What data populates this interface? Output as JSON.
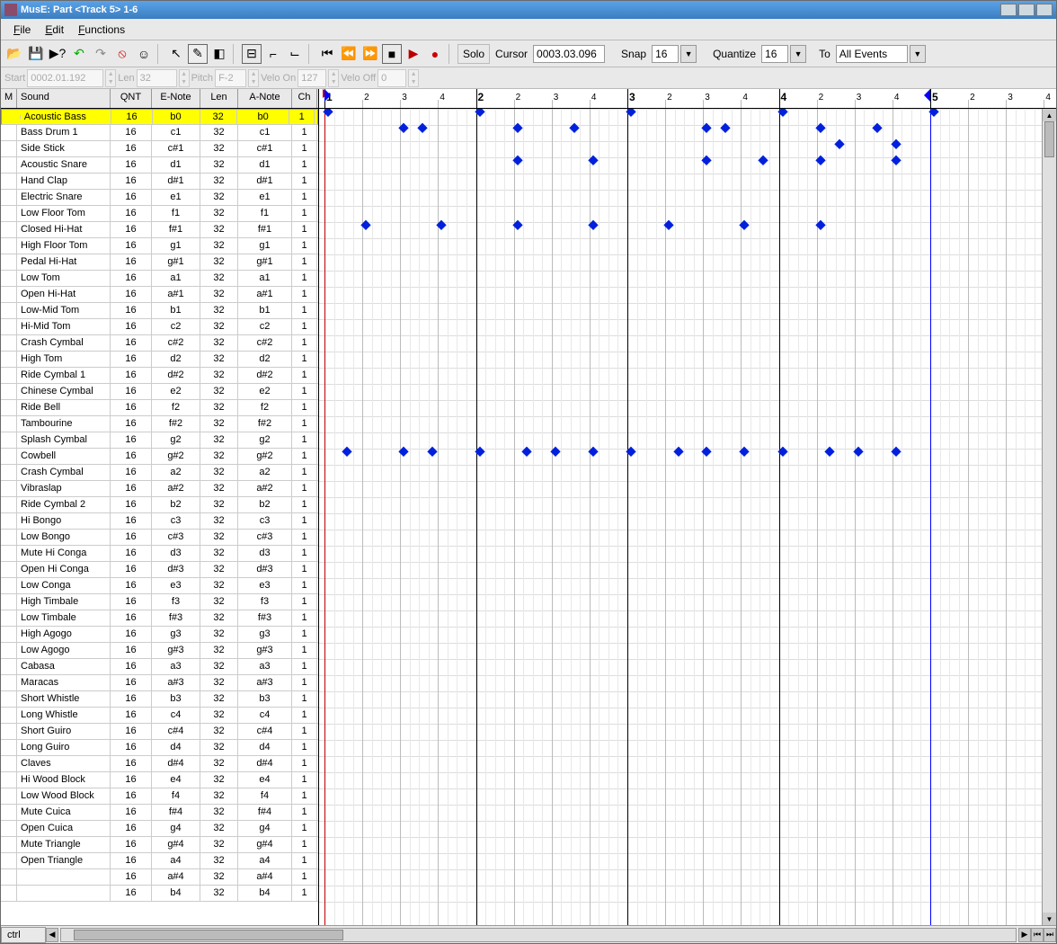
{
  "title": "MusE: Part <Track 5> 1-6",
  "menu": {
    "file": "File",
    "edit": "Edit",
    "functions": "Functions"
  },
  "toolbar": {
    "solo": "Solo",
    "cursor_lbl": "Cursor",
    "cursor_val": "0003.03.096",
    "snap_lbl": "Snap",
    "snap_val": "16",
    "quant_lbl": "Quantize",
    "quant_val": "16",
    "to_lbl": "To",
    "to_val": "All Events"
  },
  "info": {
    "start_lbl": "Start",
    "start": "0002.01.192",
    "len_lbl": "Len",
    "len": "32",
    "pitch_lbl": "Pitch",
    "pitch": "F-2",
    "von_lbl": "Velo On",
    "von": "127",
    "voff_lbl": "Velo Off",
    "voff": "0"
  },
  "headers": {
    "m": "M",
    "sound": "Sound",
    "qnt": "QNT",
    "enote": "E-Note",
    "len": "Len",
    "anote": "A-Note",
    "ch": "Ch"
  },
  "selected": 0,
  "bottom": {
    "ctrl": "ctrl"
  },
  "sounds": [
    {
      "name": "Acoustic Bass",
      "q": "16",
      "e": "b0",
      "l": "32",
      "a": "b0",
      "c": "1"
    },
    {
      "name": "Bass Drum 1",
      "q": "16",
      "e": "c1",
      "l": "32",
      "a": "c1",
      "c": "1"
    },
    {
      "name": "Side Stick",
      "q": "16",
      "e": "c#1",
      "l": "32",
      "a": "c#1",
      "c": "1"
    },
    {
      "name": "Acoustic Snare",
      "q": "16",
      "e": "d1",
      "l": "32",
      "a": "d1",
      "c": "1"
    },
    {
      "name": "Hand Clap",
      "q": "16",
      "e": "d#1",
      "l": "32",
      "a": "d#1",
      "c": "1"
    },
    {
      "name": "Electric Snare",
      "q": "16",
      "e": "e1",
      "l": "32",
      "a": "e1",
      "c": "1"
    },
    {
      "name": "Low Floor Tom",
      "q": "16",
      "e": "f1",
      "l": "32",
      "a": "f1",
      "c": "1"
    },
    {
      "name": "Closed Hi-Hat",
      "q": "16",
      "e": "f#1",
      "l": "32",
      "a": "f#1",
      "c": "1"
    },
    {
      "name": "High Floor Tom",
      "q": "16",
      "e": "g1",
      "l": "32",
      "a": "g1",
      "c": "1"
    },
    {
      "name": "Pedal Hi-Hat",
      "q": "16",
      "e": "g#1",
      "l": "32",
      "a": "g#1",
      "c": "1"
    },
    {
      "name": "Low Tom",
      "q": "16",
      "e": "a1",
      "l": "32",
      "a": "a1",
      "c": "1"
    },
    {
      "name": "Open Hi-Hat",
      "q": "16",
      "e": "a#1",
      "l": "32",
      "a": "a#1",
      "c": "1"
    },
    {
      "name": "Low-Mid Tom",
      "q": "16",
      "e": "b1",
      "l": "32",
      "a": "b1",
      "c": "1"
    },
    {
      "name": "Hi-Mid Tom",
      "q": "16",
      "e": "c2",
      "l": "32",
      "a": "c2",
      "c": "1"
    },
    {
      "name": "Crash Cymbal",
      "q": "16",
      "e": "c#2",
      "l": "32",
      "a": "c#2",
      "c": "1"
    },
    {
      "name": "High Tom",
      "q": "16",
      "e": "d2",
      "l": "32",
      "a": "d2",
      "c": "1"
    },
    {
      "name": "Ride Cymbal 1",
      "q": "16",
      "e": "d#2",
      "l": "32",
      "a": "d#2",
      "c": "1"
    },
    {
      "name": "Chinese Cymbal",
      "q": "16",
      "e": "e2",
      "l": "32",
      "a": "e2",
      "c": "1"
    },
    {
      "name": "Ride Bell",
      "q": "16",
      "e": "f2",
      "l": "32",
      "a": "f2",
      "c": "1"
    },
    {
      "name": "Tambourine",
      "q": "16",
      "e": "f#2",
      "l": "32",
      "a": "f#2",
      "c": "1"
    },
    {
      "name": "Splash Cymbal",
      "q": "16",
      "e": "g2",
      "l": "32",
      "a": "g2",
      "c": "1"
    },
    {
      "name": "Cowbell",
      "q": "16",
      "e": "g#2",
      "l": "32",
      "a": "g#2",
      "c": "1"
    },
    {
      "name": "Crash Cymbal",
      "q": "16",
      "e": "a2",
      "l": "32",
      "a": "a2",
      "c": "1"
    },
    {
      "name": "Vibraslap",
      "q": "16",
      "e": "a#2",
      "l": "32",
      "a": "a#2",
      "c": "1"
    },
    {
      "name": "Ride Cymbal 2",
      "q": "16",
      "e": "b2",
      "l": "32",
      "a": "b2",
      "c": "1"
    },
    {
      "name": "Hi Bongo",
      "q": "16",
      "e": "c3",
      "l": "32",
      "a": "c3",
      "c": "1"
    },
    {
      "name": "Low Bongo",
      "q": "16",
      "e": "c#3",
      "l": "32",
      "a": "c#3",
      "c": "1"
    },
    {
      "name": "Mute Hi Conga",
      "q": "16",
      "e": "d3",
      "l": "32",
      "a": "d3",
      "c": "1"
    },
    {
      "name": "Open Hi Conga",
      "q": "16",
      "e": "d#3",
      "l": "32",
      "a": "d#3",
      "c": "1"
    },
    {
      "name": "Low Conga",
      "q": "16",
      "e": "e3",
      "l": "32",
      "a": "e3",
      "c": "1"
    },
    {
      "name": "High Timbale",
      "q": "16",
      "e": "f3",
      "l": "32",
      "a": "f3",
      "c": "1"
    },
    {
      "name": "Low Timbale",
      "q": "16",
      "e": "f#3",
      "l": "32",
      "a": "f#3",
      "c": "1"
    },
    {
      "name": "High Agogo",
      "q": "16",
      "e": "g3",
      "l": "32",
      "a": "g3",
      "c": "1"
    },
    {
      "name": "Low Agogo",
      "q": "16",
      "e": "g#3",
      "l": "32",
      "a": "g#3",
      "c": "1"
    },
    {
      "name": "Cabasa",
      "q": "16",
      "e": "a3",
      "l": "32",
      "a": "a3",
      "c": "1"
    },
    {
      "name": "Maracas",
      "q": "16",
      "e": "a#3",
      "l": "32",
      "a": "a#3",
      "c": "1"
    },
    {
      "name": "Short Whistle",
      "q": "16",
      "e": "b3",
      "l": "32",
      "a": "b3",
      "c": "1"
    },
    {
      "name": "Long Whistle",
      "q": "16",
      "e": "c4",
      "l": "32",
      "a": "c4",
      "c": "1"
    },
    {
      "name": "Short Guiro",
      "q": "16",
      "e": "c#4",
      "l": "32",
      "a": "c#4",
      "c": "1"
    },
    {
      "name": "Long Guiro",
      "q": "16",
      "e": "d4",
      "l": "32",
      "a": "d4",
      "c": "1"
    },
    {
      "name": "Claves",
      "q": "16",
      "e": "d#4",
      "l": "32",
      "a": "d#4",
      "c": "1"
    },
    {
      "name": "Hi Wood Block",
      "q": "16",
      "e": "e4",
      "l": "32",
      "a": "e4",
      "c": "1"
    },
    {
      "name": "Low Wood Block",
      "q": "16",
      "e": "f4",
      "l": "32",
      "a": "f4",
      "c": "1"
    },
    {
      "name": "Mute Cuica",
      "q": "16",
      "e": "f#4",
      "l": "32",
      "a": "f#4",
      "c": "1"
    },
    {
      "name": "Open Cuica",
      "q": "16",
      "e": "g4",
      "l": "32",
      "a": "g4",
      "c": "1"
    },
    {
      "name": "Mute Triangle",
      "q": "16",
      "e": "g#4",
      "l": "32",
      "a": "g#4",
      "c": "1"
    },
    {
      "name": "Open Triangle",
      "q": "16",
      "e": "a4",
      "l": "32",
      "a": "a4",
      "c": "1"
    },
    {
      "name": "",
      "q": "16",
      "e": "a#4",
      "l": "32",
      "a": "a#4",
      "c": "1"
    },
    {
      "name": "",
      "q": "16",
      "e": "b4",
      "l": "32",
      "a": "b4",
      "c": "1"
    }
  ],
  "grid": {
    "bars": 5,
    "beats_per_bar": 4,
    "subs_per_beat": 4,
    "bar_width": 168.5,
    "play_bar": 1,
    "play_beat": 0,
    "locL_bar": 1,
    "locR_bar": 5,
    "offset": 6
  },
  "notes": [
    {
      "r": 0,
      "b": 1,
      "t": 0
    },
    {
      "r": 0,
      "b": 2,
      "t": 0
    },
    {
      "r": 0,
      "b": 3,
      "t": 0
    },
    {
      "r": 0,
      "b": 4,
      "t": 0
    },
    {
      "r": 0,
      "b": 5,
      "t": 0
    },
    {
      "r": 1,
      "b": 1,
      "t": 8
    },
    {
      "r": 1,
      "b": 1,
      "t": 10
    },
    {
      "r": 1,
      "b": 2,
      "t": 4
    },
    {
      "r": 1,
      "b": 2,
      "t": 10
    },
    {
      "r": 1,
      "b": 3,
      "t": 8
    },
    {
      "r": 1,
      "b": 3,
      "t": 10
    },
    {
      "r": 1,
      "b": 4,
      "t": 4
    },
    {
      "r": 1,
      "b": 4,
      "t": 10
    },
    {
      "r": 2,
      "b": 4,
      "t": 6
    },
    {
      "r": 2,
      "b": 4,
      "t": 12
    },
    {
      "r": 3,
      "b": 2,
      "t": 4
    },
    {
      "r": 3,
      "b": 2,
      "t": 12
    },
    {
      "r": 3,
      "b": 3,
      "t": 8
    },
    {
      "r": 3,
      "b": 3,
      "t": 14
    },
    {
      "r": 3,
      "b": 4,
      "t": 4
    },
    {
      "r": 3,
      "b": 4,
      "t": 12
    },
    {
      "r": 7,
      "b": 1,
      "t": 4
    },
    {
      "r": 7,
      "b": 1,
      "t": 12
    },
    {
      "r": 7,
      "b": 2,
      "t": 4
    },
    {
      "r": 7,
      "b": 2,
      "t": 12
    },
    {
      "r": 7,
      "b": 3,
      "t": 4
    },
    {
      "r": 7,
      "b": 3,
      "t": 12
    },
    {
      "r": 7,
      "b": 4,
      "t": 4
    },
    {
      "r": 21,
      "b": 1,
      "t": 2
    },
    {
      "r": 21,
      "b": 1,
      "t": 8
    },
    {
      "r": 21,
      "b": 1,
      "t": 11
    },
    {
      "r": 21,
      "b": 2,
      "t": 0
    },
    {
      "r": 21,
      "b": 2,
      "t": 5
    },
    {
      "r": 21,
      "b": 2,
      "t": 8
    },
    {
      "r": 21,
      "b": 2,
      "t": 12
    },
    {
      "r": 21,
      "b": 3,
      "t": 0
    },
    {
      "r": 21,
      "b": 3,
      "t": 5
    },
    {
      "r": 21,
      "b": 3,
      "t": 8
    },
    {
      "r": 21,
      "b": 3,
      "t": 12
    },
    {
      "r": 21,
      "b": 4,
      "t": 0
    },
    {
      "r": 21,
      "b": 4,
      "t": 5
    },
    {
      "r": 21,
      "b": 4,
      "t": 8
    },
    {
      "r": 21,
      "b": 4,
      "t": 12
    }
  ]
}
